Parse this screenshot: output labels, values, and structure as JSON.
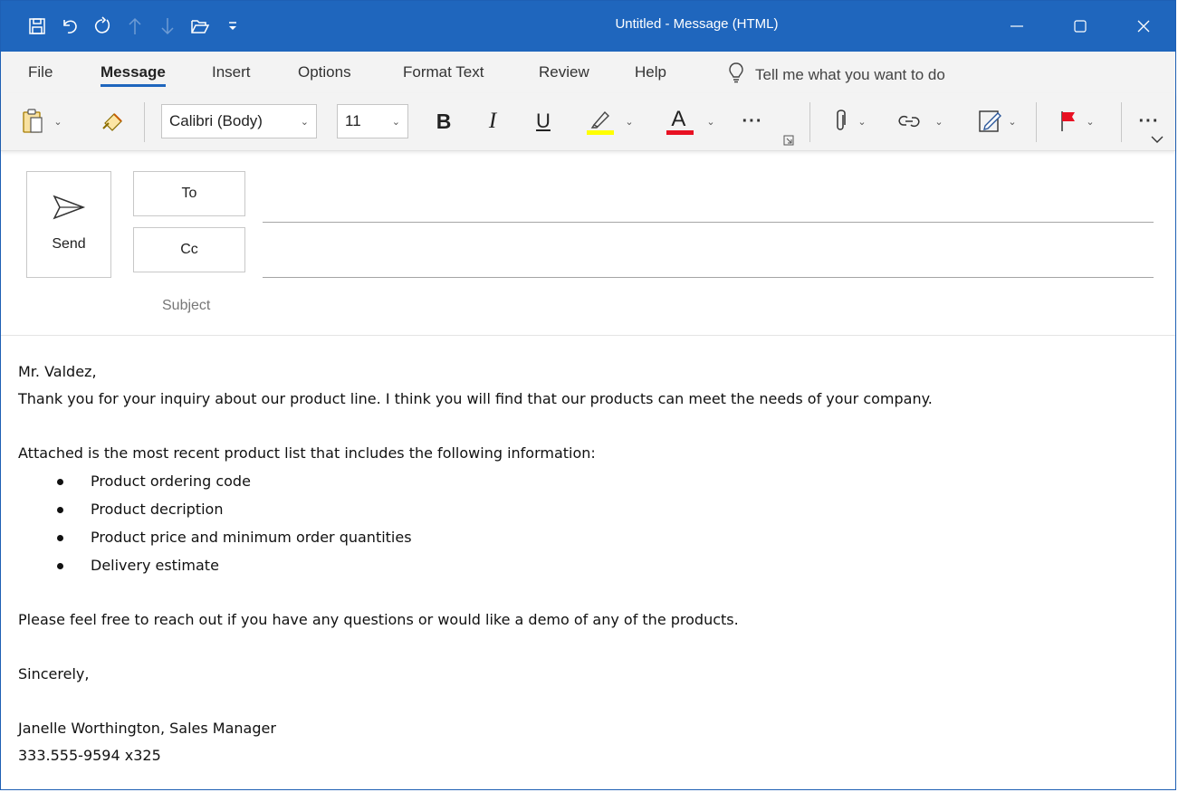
{
  "window": {
    "title": "Untitled  -  Message (HTML)",
    "accent_color": "#1f66bd"
  },
  "quick_access": {
    "icons": [
      "save-icon",
      "undo-icon",
      "redo-icon",
      "previous-item-icon",
      "next-item-icon",
      "open-icon",
      "customize-qat-icon"
    ]
  },
  "window_controls": [
    "minimize-icon",
    "restore-icon",
    "close-icon"
  ],
  "tabs": [
    {
      "label": "File"
    },
    {
      "label": "Message",
      "active": true
    },
    {
      "label": "Insert"
    },
    {
      "label": "Options"
    },
    {
      "label": "Format Text"
    },
    {
      "label": "Review"
    },
    {
      "label": "Help"
    }
  ],
  "tell_me": {
    "text": "Tell me what you want to do"
  },
  "ribbon": {
    "font_name": "Calibri (Body)",
    "font_size": "11",
    "bold": "B",
    "italic": "I",
    "underline": "U",
    "font_color_letter": "A",
    "more": "···",
    "highlight_color": "#ffff00",
    "font_color": "#e81123",
    "flag_color": "#e81123"
  },
  "header": {
    "send_label": "Send",
    "to_label": "To",
    "cc_label": "Cc",
    "subject_label": "Subject"
  },
  "email_body": {
    "greeting": "Mr. Valdez,",
    "para1": "Thank you for your inquiry about our product line.  I think you will find that our products can meet the needs of your company.",
    "para2": "Attached is the most recent product list that includes the following information:",
    "bullets": [
      "Product ordering code",
      "Product decription",
      "Product price and minimum order quantities",
      "Delivery estimate"
    ],
    "para3": "Please feel free to reach out if you have any questions or would like a demo of any of the products.",
    "closing": "Sincerely,",
    "signature_name": "Janelle Worthington, Sales Manager",
    "signature_phone": "333.555-9594 x325"
  }
}
